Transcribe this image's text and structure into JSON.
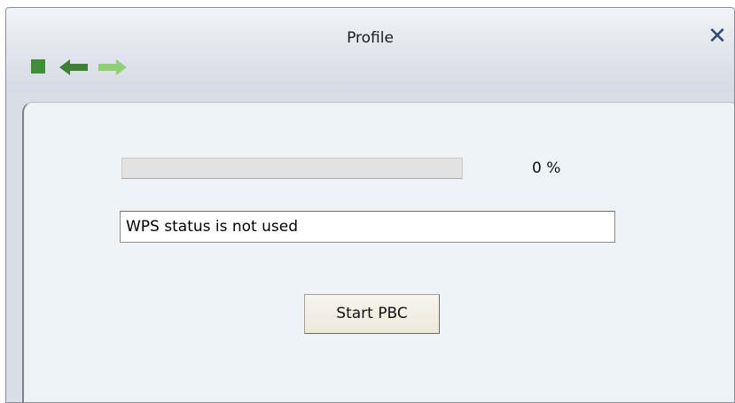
{
  "window": {
    "title": "Profile",
    "close_symbol": "✕"
  },
  "toolbar": {
    "icons": [
      "stop-icon",
      "back-arrow-icon",
      "forward-arrow-icon"
    ]
  },
  "wps": {
    "progress_percent": 0,
    "progress_text": "0 %",
    "status_text": "WPS status is not used",
    "start_button_label": "Start PBC"
  },
  "colors": {
    "icon_green": "#3f8f38",
    "icon_light_green": "#8fcf7a",
    "close_blue": "#2f4a70"
  }
}
